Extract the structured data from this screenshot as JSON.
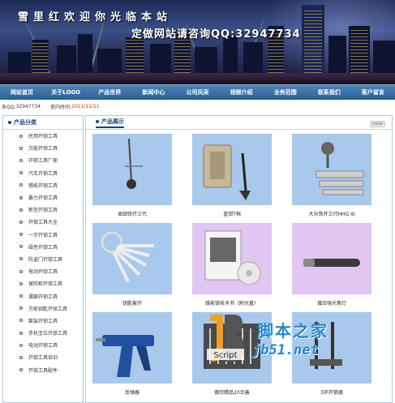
{
  "banner": {
    "title": "雪里红欢迎你光临本站",
    "subtitle": "定做网站请咨询QQ:32947734"
  },
  "nav": {
    "items": [
      {
        "label": "网站首页"
      },
      {
        "label": "关于LOGO"
      },
      {
        "label": "产品世界"
      },
      {
        "label": "新闻中心"
      },
      {
        "label": "公司风采"
      },
      {
        "label": "视频介绍"
      },
      {
        "label": "业务范围"
      },
      {
        "label": "联系我们"
      },
      {
        "label": "客户留言"
      }
    ]
  },
  "infobar": {
    "prefix": "系QQ:",
    "qq": "32947734",
    "date_label": "室内时间:",
    "date": "2011/11/11"
  },
  "sidebar": {
    "title": "产品分类",
    "items": [
      {
        "label": "民用开锁工具"
      },
      {
        "label": "万能开锁工具"
      },
      {
        "label": "开锁工具厂家"
      },
      {
        "label": "汽车开锁工具"
      },
      {
        "label": "锡纸开锁工具"
      },
      {
        "label": "暴力开锁工具"
      },
      {
        "label": "新型开锁工具"
      },
      {
        "label": "开锁工具大全"
      },
      {
        "label": "一字开锁工具"
      },
      {
        "label": "磁性开锁工具"
      },
      {
        "label": "防盗门开锁工具"
      },
      {
        "label": "电动开锁工具"
      },
      {
        "label": "保险柜开锁工具"
      },
      {
        "label": "漏鎖开锁工具"
      },
      {
        "label": "万能钥匙开锁工具"
      },
      {
        "label": "套装开锁工具"
      },
      {
        "label": "手机宝位开锁工具"
      },
      {
        "label": "电动开锁工具"
      },
      {
        "label": "开锁工具培训"
      },
      {
        "label": "开锁工具配件"
      }
    ]
  },
  "main": {
    "title": "产品展示",
    "more": "more",
    "products": [
      {
        "caption": "本田铁开三代",
        "bg": "#a8c8ec"
      },
      {
        "caption": "蓝钳T档",
        "bg": "#a8c8ec"
      },
      {
        "caption": "大众铁开三代HHG III",
        "bg": "#a8c8ec"
      },
      {
        "caption": "钥匙套开",
        "bg": "#a8c8ec"
      },
      {
        "caption": "维能锁技术书（附光盘）",
        "bg": "#e0c6f0"
      },
      {
        "caption": "增压强光笔灯",
        "bg": "#e0c6f0"
      },
      {
        "caption": "反弹器",
        "bg": "#a8c8ec"
      },
      {
        "caption": "德欣精品20合善",
        "bg": "#a8c8ec"
      },
      {
        "caption": "3环开锁器",
        "bg": "#a8c8ec"
      }
    ]
  },
  "watermark": {
    "logo_text": "Script",
    "brand": "脚本之家",
    "site": "jb51.net"
  }
}
